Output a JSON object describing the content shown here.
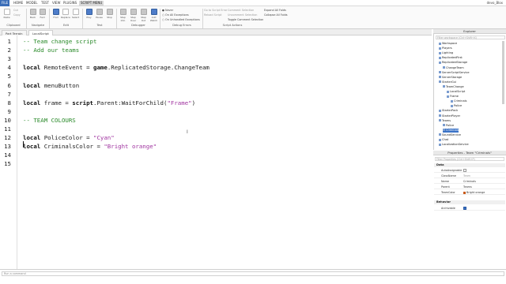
{
  "menubar": {
    "file": "FILE",
    "tabs": [
      "HOME",
      "MODEL",
      "TEST",
      "VIEW",
      "PLUGINS",
      "SCRIPT MENU"
    ],
    "user": "devo_Blox"
  },
  "ribbon": {
    "clipboard": {
      "paste": "Paste",
      "cut": "Cut",
      "copy": "Copy",
      "label": "Clipboard"
    },
    "navigate": {
      "back": "Back",
      "forward": "Fwd",
      "label": "Navigate"
    },
    "edit": {
      "find": "Find",
      "replace": "Replace",
      "select": "Select",
      "label": "Edit"
    },
    "test": {
      "play": "Play",
      "pause": "Pause",
      "stop": "Stop",
      "label": "Test"
    },
    "debugger": {
      "step_into": "Step Into",
      "step_over": "Step Over",
      "step_out": "Step Out",
      "add_watch": "Add Watch",
      "label": "Debugger"
    },
    "debug_errors": {
      "never": "Never",
      "all": "On All Exceptions",
      "unhandled": "On Unhandled Exceptions",
      "label": "Debug Errors"
    },
    "script_actions": {
      "go_to": "Go to Script Error",
      "reload": "Reload Script",
      "comment": "Comment Selection",
      "uncomment": "Uncomment Selection",
      "toggle": "Toggle Comment Selection",
      "expand": "Expand All Folds",
      "collapse": "Collapse All Folds",
      "label": "Script Actions"
    }
  },
  "doc_tabs": [
    "Part Terrain",
    "LocalScript"
  ],
  "editor": {
    "line_numbers": [
      "1",
      "2",
      "3",
      "4",
      "5",
      "6",
      "7",
      "8",
      "9",
      "10",
      "11",
      "12",
      "13",
      "14",
      "15"
    ],
    "lines": [
      [
        {
          "t": "-- Team change script",
          "c": "cm"
        }
      ],
      [
        {
          "t": "-- Add our teams",
          "c": "cm"
        }
      ],
      [],
      [
        {
          "t": "local",
          "c": "kw"
        },
        {
          "t": " RemoteEvent = ",
          "c": ""
        },
        {
          "t": "game",
          "c": "kw"
        },
        {
          "t": ".ReplicatedStorage.ChangeTeam",
          "c": ""
        }
      ],
      [],
      [
        {
          "t": "local",
          "c": "kw"
        },
        {
          "t": " menuButton",
          "c": ""
        }
      ],
      [],
      [
        {
          "t": "local",
          "c": "kw"
        },
        {
          "t": " frame = ",
          "c": ""
        },
        {
          "t": "script",
          "c": "kw"
        },
        {
          "t": ".Parent:WaitForChild(",
          "c": ""
        },
        {
          "t": "\"Frame\"",
          "c": "str"
        },
        {
          "t": ")",
          "c": ""
        }
      ],
      [],
      [
        {
          "t": "-- TEAM COLOURS",
          "c": "cm"
        }
      ],
      [],
      [
        {
          "t": "local",
          "c": "kw"
        },
        {
          "t": " PoliceColor = ",
          "c": ""
        },
        {
          "t": "\"Cyan\"",
          "c": "str"
        }
      ],
      [
        {
          "t": "local",
          "c": "kw"
        },
        {
          "t": " CriminalsColor = ",
          "c": ""
        },
        {
          "t": "\"Bright orange\"",
          "c": "str"
        }
      ],
      [],
      []
    ]
  },
  "command_bar": {
    "placeholder": "Run a command"
  },
  "explorer": {
    "title": "Explorer",
    "filter_placeholder": "Filter workspace (Ctrl+Shift+X)",
    "items": [
      {
        "label": "Workspace",
        "indent": 0
      },
      {
        "label": "Players",
        "indent": 0
      },
      {
        "label": "Lighting",
        "indent": 0
      },
      {
        "label": "ReplicatedFirst",
        "indent": 0
      },
      {
        "label": "ReplicatedStorage",
        "indent": 0
      },
      {
        "label": "ChangeTeam",
        "indent": 1
      },
      {
        "label": "ServerScriptService",
        "indent": 0
      },
      {
        "label": "ServerStorage",
        "indent": 0
      },
      {
        "label": "StarterGui",
        "indent": 0
      },
      {
        "label": "TeamChange",
        "indent": 1
      },
      {
        "label": "LocalScript",
        "indent": 2
      },
      {
        "label": "Frame",
        "indent": 2
      },
      {
        "label": "Criminals",
        "indent": 3
      },
      {
        "label": "Police",
        "indent": 3
      },
      {
        "label": "StarterPack",
        "indent": 0
      },
      {
        "label": "StarterPlayer",
        "indent": 0
      },
      {
        "label": "Teams",
        "indent": 0
      },
      {
        "label": "Police",
        "indent": 1
      },
      {
        "label": "Criminals",
        "indent": 1,
        "selected": true
      },
      {
        "label": "SoundService",
        "indent": 0
      },
      {
        "label": "Chat",
        "indent": 0
      },
      {
        "label": "LocalizationService",
        "indent": 0
      }
    ]
  },
  "properties": {
    "title": "Properties - Team \"Criminals\"",
    "filter_placeholder": "Filter Properties (Ctrl+Shift+P)",
    "data_section": "Data",
    "rows": [
      {
        "key": "AutoAssignable",
        "value": "",
        "type": "checkbox",
        "checked": false
      },
      {
        "key": "ClassName",
        "value": "Team",
        "dim": true
      },
      {
        "key": "Name",
        "value": "Criminals"
      },
      {
        "key": "Parent",
        "value": "Teams"
      },
      {
        "key": "TeamColor",
        "value": "Bright orange",
        "type": "color",
        "color": "#c85a1a"
      }
    ],
    "behavior_section": "Behavior",
    "behavior_rows": [
      {
        "key": "Archivable",
        "value": "",
        "type": "checkbox",
        "checked": true
      }
    ]
  }
}
